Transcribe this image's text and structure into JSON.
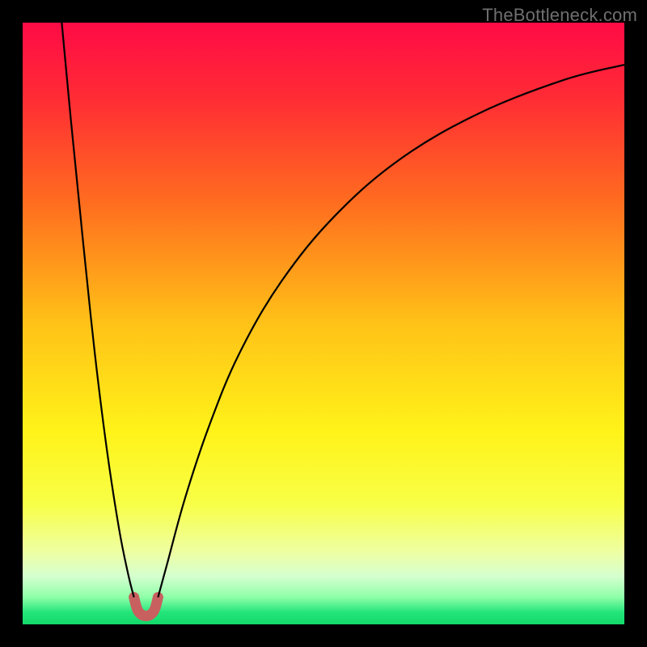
{
  "watermark": "TheBottleneck.com",
  "chart_data": {
    "type": "line",
    "title": "",
    "xlabel": "",
    "ylabel": "",
    "xlim": [
      0,
      100
    ],
    "ylim": [
      0,
      100
    ],
    "grid": false,
    "legend": false,
    "gradient_stops": [
      {
        "pos": 0.0,
        "color": "#ff0b46"
      },
      {
        "pos": 0.12,
        "color": "#ff2a35"
      },
      {
        "pos": 0.3,
        "color": "#ff6d1f"
      },
      {
        "pos": 0.5,
        "color": "#ffc217"
      },
      {
        "pos": 0.68,
        "color": "#fff319"
      },
      {
        "pos": 0.8,
        "color": "#f8ff47"
      },
      {
        "pos": 0.88,
        "color": "#eeffa3"
      },
      {
        "pos": 0.92,
        "color": "#d5ffcf"
      },
      {
        "pos": 0.955,
        "color": "#8effa8"
      },
      {
        "pos": 0.98,
        "color": "#23e57a"
      },
      {
        "pos": 1.0,
        "color": "#14d96a"
      }
    ],
    "series": [
      {
        "name": "left-branch",
        "stroke": "#000000",
        "stroke_width": 2.2,
        "points": [
          {
            "x": 6.5,
            "y": 100.0
          },
          {
            "x": 8.0,
            "y": 84.0
          },
          {
            "x": 10.0,
            "y": 64.0
          },
          {
            "x": 12.0,
            "y": 45.0
          },
          {
            "x": 14.0,
            "y": 29.0
          },
          {
            "x": 16.0,
            "y": 16.0
          },
          {
            "x": 17.5,
            "y": 8.5
          },
          {
            "x": 18.5,
            "y": 4.5
          }
        ]
      },
      {
        "name": "right-branch",
        "stroke": "#000000",
        "stroke_width": 2.2,
        "points": [
          {
            "x": 22.5,
            "y": 4.5
          },
          {
            "x": 24.0,
            "y": 10.0
          },
          {
            "x": 27.0,
            "y": 21.0
          },
          {
            "x": 31.0,
            "y": 33.0
          },
          {
            "x": 36.0,
            "y": 45.0
          },
          {
            "x": 43.0,
            "y": 57.0
          },
          {
            "x": 52.0,
            "y": 68.0
          },
          {
            "x": 63.0,
            "y": 77.5
          },
          {
            "x": 76.0,
            "y": 85.0
          },
          {
            "x": 90.0,
            "y": 90.5
          },
          {
            "x": 100.0,
            "y": 93.0
          }
        ]
      },
      {
        "name": "valley-highlight",
        "stroke": "#c86060",
        "stroke_width": 13,
        "linecap": "round",
        "points": [
          {
            "x": 18.5,
            "y": 4.5
          },
          {
            "x": 19.2,
            "y": 2.2
          },
          {
            "x": 20.5,
            "y": 1.4
          },
          {
            "x": 21.8,
            "y": 2.2
          },
          {
            "x": 22.5,
            "y": 4.5
          }
        ]
      }
    ]
  }
}
